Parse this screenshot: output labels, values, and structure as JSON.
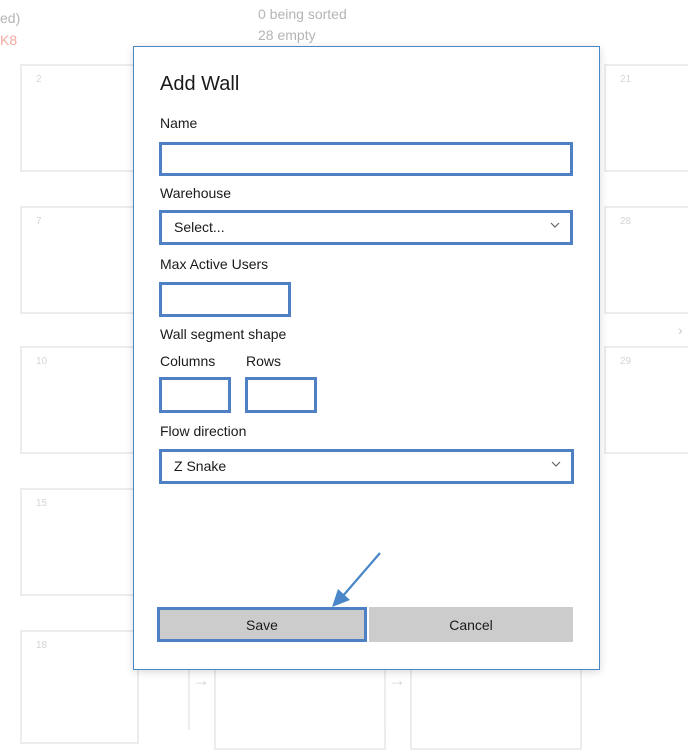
{
  "background": {
    "header_left_1": "ed)",
    "header_left_2": "K8",
    "header_center_1": "0 being sorted",
    "header_center_2": "28 empty",
    "tiles": [
      "2",
      "7",
      "10",
      "15",
      "18",
      "21",
      "28",
      "29"
    ]
  },
  "dialog": {
    "title": "Add Wall",
    "name_label": "Name",
    "name_value": "",
    "warehouse_label": "Warehouse",
    "warehouse_value": "Select...",
    "max_users_label": "Max Active Users",
    "max_users_value": "",
    "segment_label": "Wall segment shape",
    "columns_label": "Columns",
    "rows_label": "Rows",
    "columns_value": "",
    "rows_value": "",
    "flow_label": "Flow direction",
    "flow_value": "Z Snake",
    "save_label": "Save",
    "cancel_label": "Cancel"
  },
  "colors": {
    "accent": "#4f80c4",
    "button_bg": "#cccccc",
    "annotation_arrow": "#4a86c8"
  }
}
